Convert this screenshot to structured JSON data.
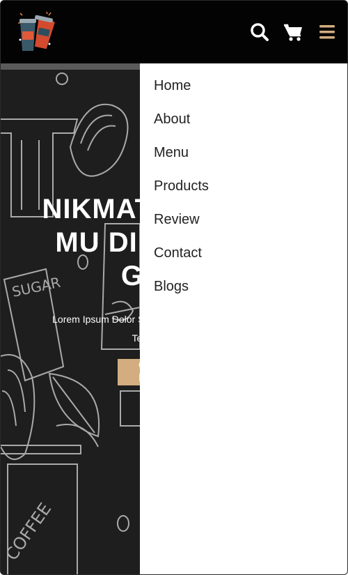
{
  "header": {
    "logo_icon": "coffee-cups-logo-icon",
    "search_icon": "search-icon",
    "cart_icon": "cart-icon",
    "menu_icon": "hamburger-menu-icon",
    "menu_icon_color": "#d3ad7f"
  },
  "hero": {
    "title_lines": [
      "NIKMATI SEGELAS",
      "MU DI PAGI HARI",
      "GRATIS"
    ],
    "text_lines": [
      "Lorem Ipsum Dolor Sit Amet Consectetur Adipisicing Elit.",
      "Tempore, Cumque?"
    ],
    "button_label": "Order Now",
    "accent_color": "#d3ad7f"
  },
  "nav": {
    "items": [
      {
        "label": "Home"
      },
      {
        "label": "About"
      },
      {
        "label": "Menu"
      },
      {
        "label": "Products"
      },
      {
        "label": "Review"
      },
      {
        "label": "Contact"
      },
      {
        "label": "Blogs"
      }
    ]
  }
}
